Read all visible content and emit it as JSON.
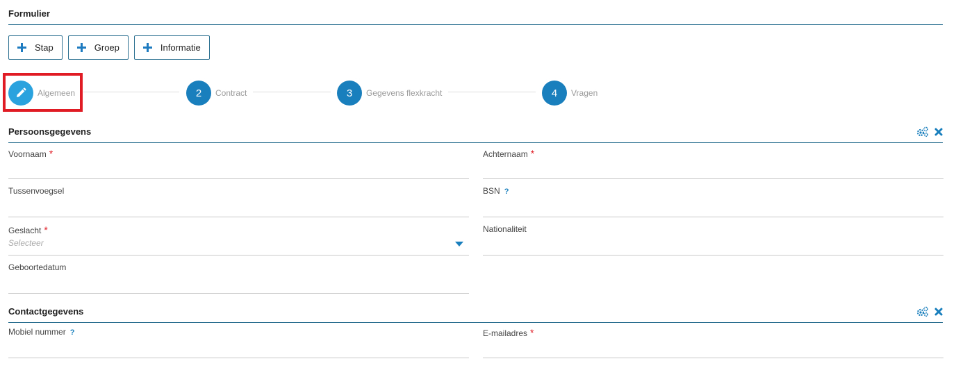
{
  "form": {
    "title": "Formulier"
  },
  "toolbar": {
    "buttons": [
      {
        "label": "Stap",
        "icon": "plus-icon"
      },
      {
        "label": "Groep",
        "icon": "plus-icon"
      },
      {
        "label": "Informatie",
        "icon": "plus-icon"
      }
    ]
  },
  "stepper": {
    "steps": [
      {
        "number": "",
        "icon": "pencil-icon",
        "label": "Algemeen",
        "active": true
      },
      {
        "number": "2",
        "label": "Contract",
        "active": false
      },
      {
        "number": "3",
        "label": "Gegevens flexkracht",
        "active": false
      },
      {
        "number": "4",
        "label": "Vragen",
        "active": false
      }
    ]
  },
  "sections": [
    {
      "title": "Persoonsgegevens",
      "icons": [
        "gears-icon",
        "close-icon"
      ],
      "fields": [
        {
          "label": "Voornaam",
          "required": "*",
          "help": ""
        },
        {
          "label": "Achternaam",
          "required": "*",
          "help": ""
        },
        {
          "label": "Tussenvoegsel",
          "required": "",
          "help": ""
        },
        {
          "label": "BSN",
          "required": "",
          "help": "?"
        },
        {
          "label": "Geslacht",
          "required": "*",
          "help": "",
          "placeholder": "Selecteer"
        },
        {
          "label": "Nationaliteit",
          "required": "",
          "help": ""
        },
        {
          "label": "Geboortedatum",
          "required": "",
          "help": ""
        }
      ]
    },
    {
      "title": "Contactgegevens",
      "icons": [
        "gears-icon",
        "close-icon"
      ],
      "fields": [
        {
          "label": "Mobiel nummer",
          "required": "",
          "help": "?"
        },
        {
          "label": "E-mailadres",
          "required": "*",
          "help": ""
        }
      ]
    }
  ],
  "colors": {
    "accent": "#1a7fbd",
    "active_step": "#2aa2dd",
    "required": "#e01b24",
    "highlight": "#e01b24",
    "rule": "#2a6f8f"
  }
}
